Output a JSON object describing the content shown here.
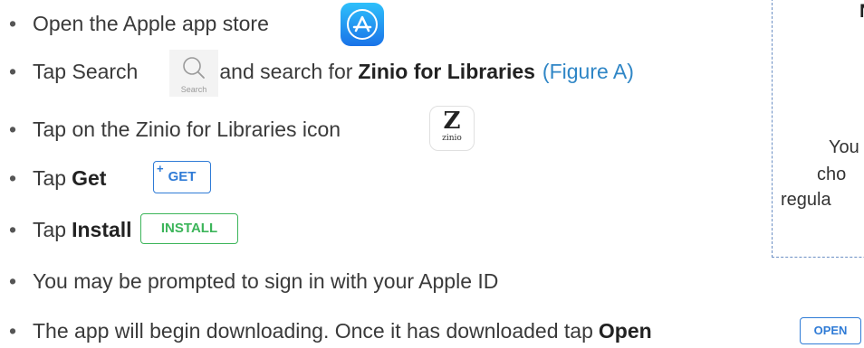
{
  "steps": [
    {
      "prefix": "Open the Apple app store",
      "icon": "app-store-icon"
    },
    {
      "prefix": "Tap Search",
      "middle": "and search for",
      "bold": "Zinio for Libraries",
      "figure": "(Figure A)",
      "icon": "search-icon",
      "icon_caption": "Search"
    },
    {
      "prefix": "Tap on the Zinio for Libraries icon",
      "icon": "zinio-app-icon",
      "icon_letter": "Z",
      "icon_text": "zinio"
    },
    {
      "prefix": "Tap",
      "bold": "Get",
      "button_label": "GET",
      "button_plus": "+"
    },
    {
      "prefix": "Tap",
      "bold": "Install",
      "button_label": "INSTALL"
    },
    {
      "prefix": "You may be prompted to sign in with your Apple ID"
    },
    {
      "prefix": "The app will begin downloading. Once it has downloaded tap",
      "bold": "Open",
      "button_label": "OPEN"
    }
  ],
  "bullet": "•",
  "note": {
    "heading": "N",
    "lines": [
      "You",
      "cho",
      "regula"
    ]
  },
  "colors": {
    "text": "#3a3a3a",
    "figure_link": "#2f86c6",
    "store_blue": "#2f7bd6",
    "install_green": "#3cb55a",
    "note_border": "#6b8fc4"
  }
}
